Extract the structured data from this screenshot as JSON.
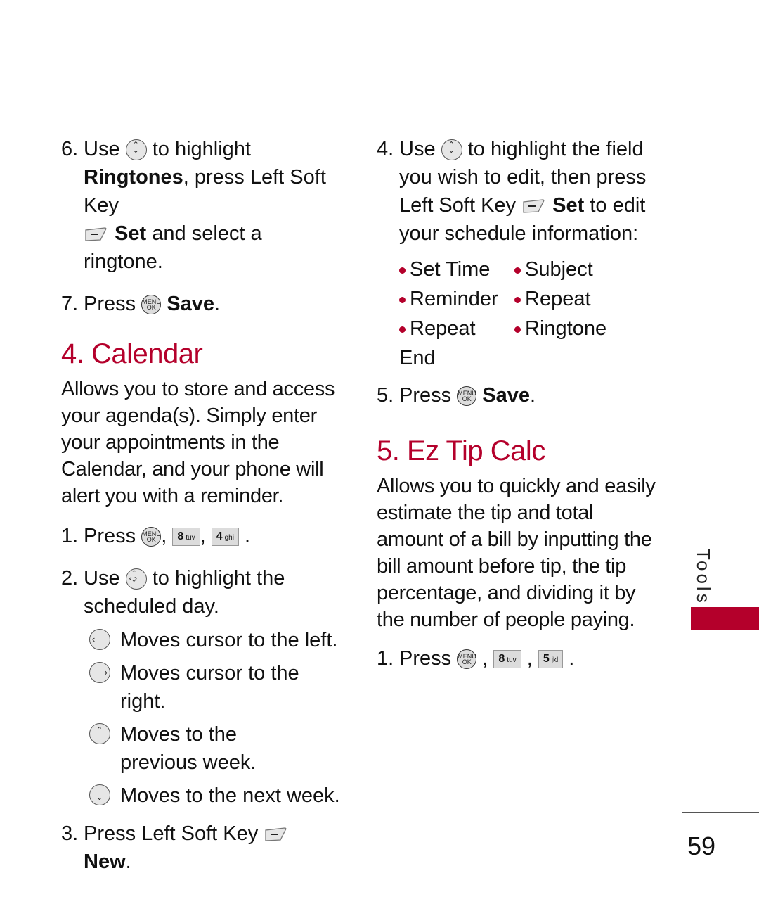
{
  "left": {
    "step6": {
      "num": "6.",
      "a": "Use",
      "b": "to highlight",
      "bold1": "Ringtones",
      "c": ", press Left Soft Key",
      "bold2": "Set",
      "d": " and select a ringtone."
    },
    "step7": {
      "num": "7.",
      "a": "Press",
      "bold": "Save",
      "end": "."
    },
    "section_title": "4. Calendar",
    "description": [
      "Allows you to store and access",
      "your agenda(s). Simply enter",
      "your appointments in the",
      "Calendar, and your phone will",
      "alert you with a reminder."
    ],
    "step1": {
      "num": "1.",
      "a": "Press",
      "sep": ",",
      "key1_num": "8",
      "key1_letters": "tuv",
      "key2_num": "4",
      "key2_letters": "ghi",
      "end": "."
    },
    "step2": {
      "num": "2.",
      "a": "Use",
      "b": "to highlight the",
      "c": "scheduled day."
    },
    "nav_items": [
      {
        "icon": "nav-left-icon",
        "text": "Moves cursor to the left."
      },
      {
        "icon": "nav-right-icon",
        "text": "Moves cursor to the right."
      },
      {
        "icon": "nav-up-icon",
        "text": "Moves to the previous week."
      },
      {
        "icon": "nav-down-icon",
        "text": "Moves to the next week."
      }
    ],
    "step3": {
      "num": "3.",
      "a": "Press Left Soft Key",
      "bold": "New",
      "end": "."
    }
  },
  "right": {
    "step4": {
      "num": "4.",
      "a": "Use",
      "b": "to highlight the field",
      "c": "you wish to edit, then press",
      "d": "Left Soft Key",
      "bold": "Set",
      "e": " to edit",
      "f": "your schedule information:"
    },
    "fields": [
      [
        "Set Time",
        "Subject"
      ],
      [
        "Reminder",
        "Repeat"
      ],
      [
        "Repeat End",
        "Ringtone"
      ]
    ],
    "step5": {
      "num": "5.",
      "a": "Press",
      "bold": "Save",
      "end": "."
    },
    "section_title": "5. Ez Tip Calc",
    "description": [
      "Allows you to quickly and easily",
      "estimate the tip and total",
      "amount of a bill by inputting the",
      "bill amount before tip, the tip",
      "percentage, and dividing it by",
      "the number of people paying."
    ],
    "step1": {
      "num": "1.",
      "a": "Press",
      "sep": ",",
      "key1_num": "8",
      "key1_letters": "tuv",
      "key2_num": "5",
      "key2_letters": "jkl",
      "end": "."
    }
  },
  "ok_key": {
    "top": "MENU",
    "bottom": "OK"
  },
  "side_tab": "Tools",
  "accent_color": "#b4002b",
  "page_number": "59"
}
